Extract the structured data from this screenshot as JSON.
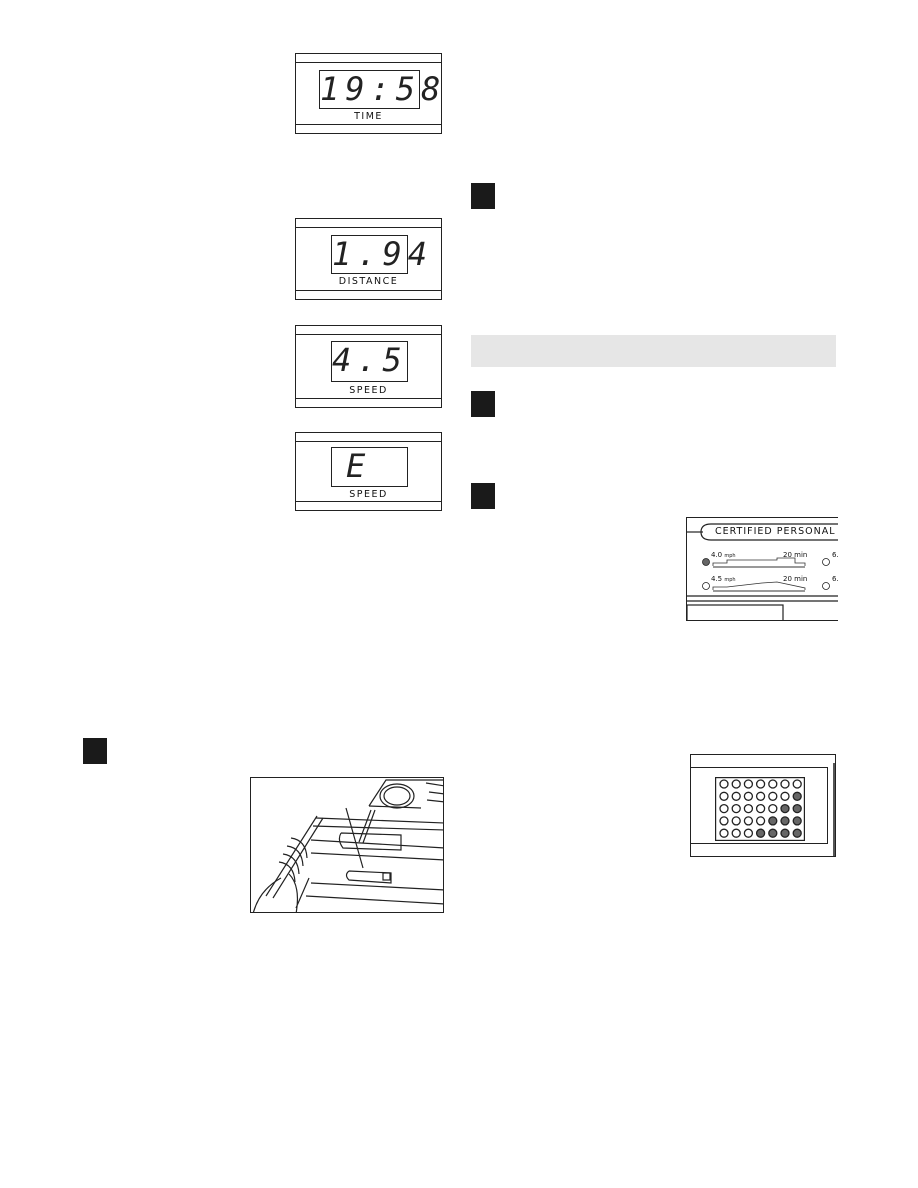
{
  "displays": [
    {
      "value": "19:58",
      "label": "TIME"
    },
    {
      "value": "1.94",
      "label": "DISTANCE"
    },
    {
      "value": "4.5",
      "label": "SPEED"
    },
    {
      "value": "E",
      "label": "SPEED"
    }
  ],
  "program_panel": {
    "title": "CERTIFIED PERSONAL TR",
    "programs": [
      {
        "speed": "4.0",
        "unit": "mph",
        "time": "20 min",
        "selected": true
      },
      {
        "speed": "4.5",
        "unit": "mph",
        "time": "20 min",
        "selected": false
      }
    ],
    "right_column": [
      "6.",
      "6."
    ]
  },
  "dot_matrix": {
    "rows": 5,
    "cols": 7,
    "filled_per_row": [
      0,
      1,
      2,
      3,
      4
    ]
  },
  "colors": {
    "band": "#e6e6e6",
    "ink": "#1a1a1a",
    "dot_fill": "#666666"
  }
}
